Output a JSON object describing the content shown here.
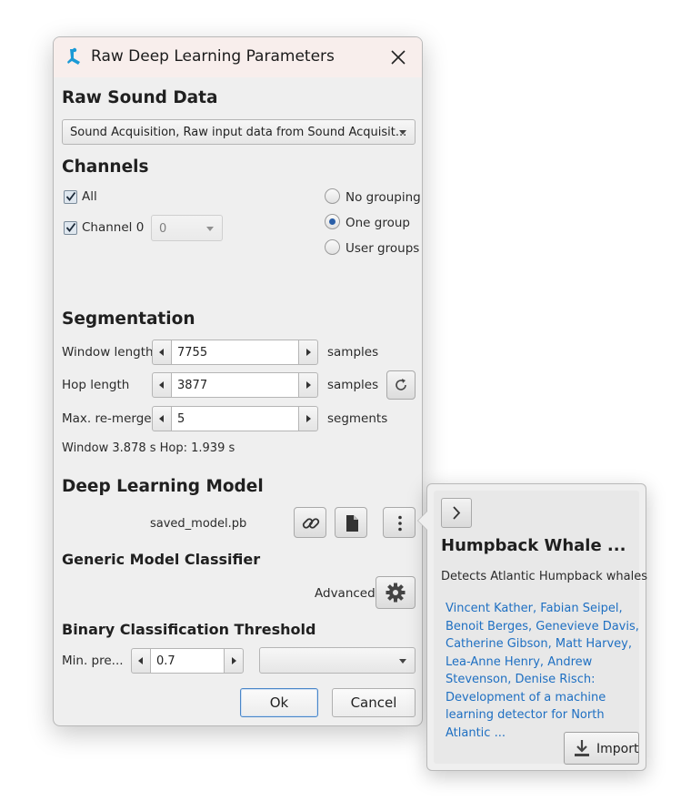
{
  "window": {
    "title": "Raw Deep Learning Parameters",
    "icon": "app-logo-icon",
    "close_icon": "close-icon"
  },
  "raw_sound": {
    "heading": "Raw Sound Data",
    "source_selected": "Sound Acquisition, Raw input data from Sound Acquisit..."
  },
  "channels": {
    "heading": "Channels",
    "all_label": "All",
    "all_checked": true,
    "channel0_label": "Channel 0",
    "channel0_checked": true,
    "channel_group_value": "0",
    "grouping": [
      {
        "label": "No grouping",
        "selected": false
      },
      {
        "label": "One group",
        "selected": true
      },
      {
        "label": "User groups",
        "selected": false
      }
    ]
  },
  "segmentation": {
    "heading": "Segmentation",
    "window_label": "Window length",
    "window_value": "7755",
    "window_unit": "samples",
    "hop_label": "Hop length",
    "hop_value": "3877",
    "hop_unit": "samples",
    "remerge_label": "Max. re-merge",
    "remerge_value": "5",
    "remerge_unit": "segments",
    "summary": "Window 3.878 s Hop: 1.939 s"
  },
  "model": {
    "heading": "Deep Learning Model",
    "file": "saved_model.pb",
    "buttons": [
      "link-icon",
      "file-icon",
      "more-vertical-icon"
    ]
  },
  "classifier": {
    "heading": "Generic Model Classifier",
    "advanced_label": "Advanced"
  },
  "threshold": {
    "heading": "Binary Classification Threshold",
    "min_label": "Min. pre...",
    "min_value": "0.7",
    "class_selected": ""
  },
  "actions": {
    "ok": "Ok",
    "cancel": "Cancel"
  },
  "popover": {
    "title": "Humpback Whale ...",
    "description": "Detects Atlantic Humpback whales",
    "citation": "Vincent Kather, Fabian Seipel, Benoit Berges, Genevieve Davis, Catherine Gibson, Matt Harvey, Lea-Anne Henry, Andrew Stevenson, Denise Risch: Development of a machine learning detector for North Atlantic ...",
    "import_label": "Import"
  },
  "colors": {
    "titlebar": "#f8eeec",
    "dialog_bg": "#efefef",
    "link": "#1e6fc2",
    "radio_dot": "#2a5fa8",
    "logo": "#1a9ad6"
  }
}
